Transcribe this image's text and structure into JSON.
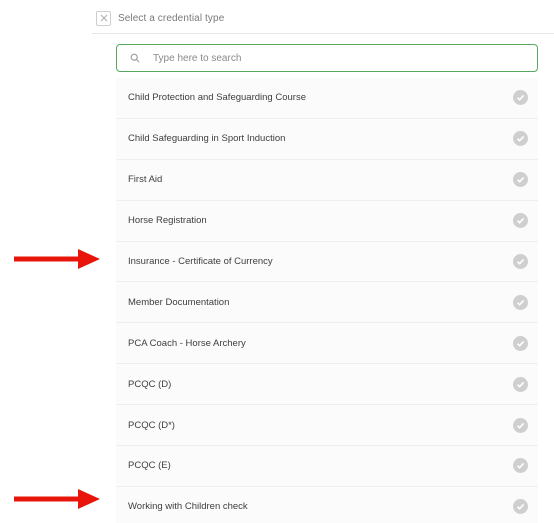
{
  "header": {
    "title": "Select a credential type"
  },
  "search": {
    "placeholder": "Type here to search",
    "value": ""
  },
  "credentials": [
    {
      "label": "Child Protection and Safeguarding Course"
    },
    {
      "label": "Child Safeguarding in Sport Induction"
    },
    {
      "label": "First Aid"
    },
    {
      "label": "Horse Registration"
    },
    {
      "label": "Insurance - Certificate of Currency"
    },
    {
      "label": "Member Documentation"
    },
    {
      "label": "PCA Coach - Horse Archery"
    },
    {
      "label": "PCQC (D)"
    },
    {
      "label": "PCQC (D*)"
    },
    {
      "label": "PCQC (E)"
    },
    {
      "label": "Working with Children check"
    }
  ],
  "icons": {
    "close": "close-icon",
    "search": "search-icon",
    "check": "check-icon",
    "arrow": "arrow-right-icon"
  },
  "colors": {
    "accent_border": "#57a85e",
    "check_grey": "#cfcfcf",
    "arrow_red": "#e8150b"
  }
}
